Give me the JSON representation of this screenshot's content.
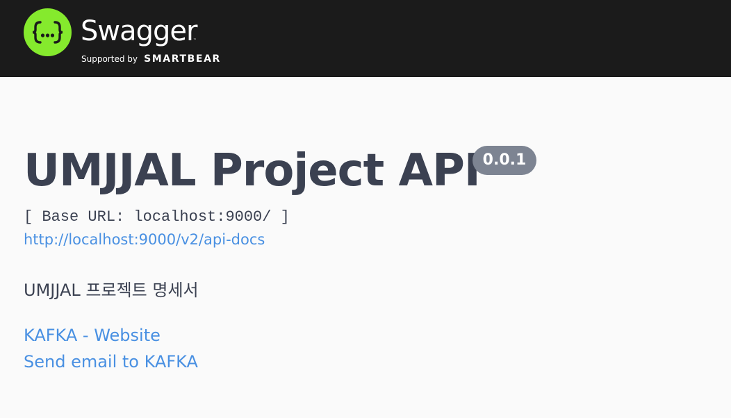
{
  "topbar": {
    "logo_icon_text": "{...}",
    "brand": "Swagger",
    "trademark": "™",
    "supported_by": "Supported by",
    "company": "SMARTBEAR",
    "colors": {
      "background": "#1b1b1b",
      "logo": "#85ea2d"
    }
  },
  "info": {
    "title": "UMJJAL Project API",
    "version": "0.0.1",
    "base_url": "[ Base URL: localhost:9000/ ]",
    "docs_url": "http://localhost:9000/v2/api-docs",
    "description": "UMJJAL 프로젝트 명세서",
    "contact_website_label": "KAFKA - Website",
    "contact_email_label": "Send email to KAFKA",
    "colors": {
      "title": "#3b4151",
      "badge": "#7d8492",
      "link": "#4990e2"
    }
  }
}
